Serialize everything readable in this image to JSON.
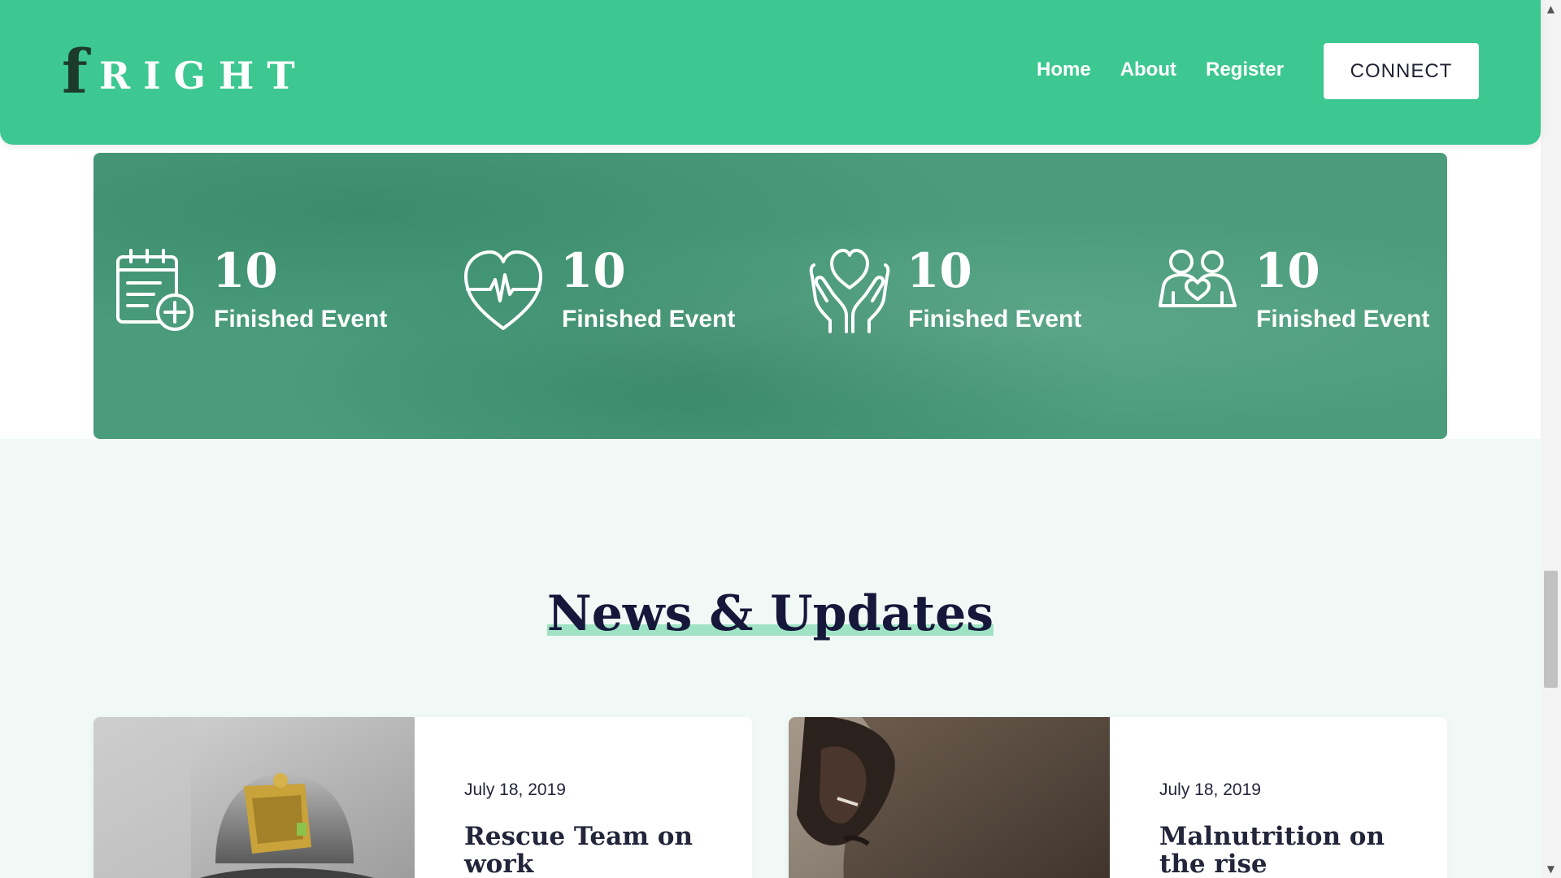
{
  "header": {
    "logo_mark": "f",
    "logo_text": "RIGHT",
    "nav": [
      "Home",
      "About",
      "Register"
    ],
    "cta": "CONNECT"
  },
  "stats": [
    {
      "icon": "calendar-add-icon",
      "value": "10",
      "label": "Finished Event"
    },
    {
      "icon": "heartbeat-icon",
      "value": "10",
      "label": "Finished Event"
    },
    {
      "icon": "hands-heart-icon",
      "value": "10",
      "label": "Finished Event"
    },
    {
      "icon": "people-heart-icon",
      "value": "10",
      "label": "Finished Event"
    }
  ],
  "news": {
    "title": "News & Updates",
    "cards": [
      {
        "date": "July 18, 2019",
        "title": "Rescue Team on work",
        "image": "firefighter-photo"
      },
      {
        "date": "July 18, 2019",
        "title": "Malnutrition on the rise",
        "image": "person-hood-photo"
      }
    ]
  },
  "colors": {
    "brand_green": "#3dc791",
    "stats_band": "#4a9c7c",
    "section_bg": "#f1f9f6",
    "heading_dark": "#15183a",
    "underline_mint": "#9fe3c4"
  }
}
